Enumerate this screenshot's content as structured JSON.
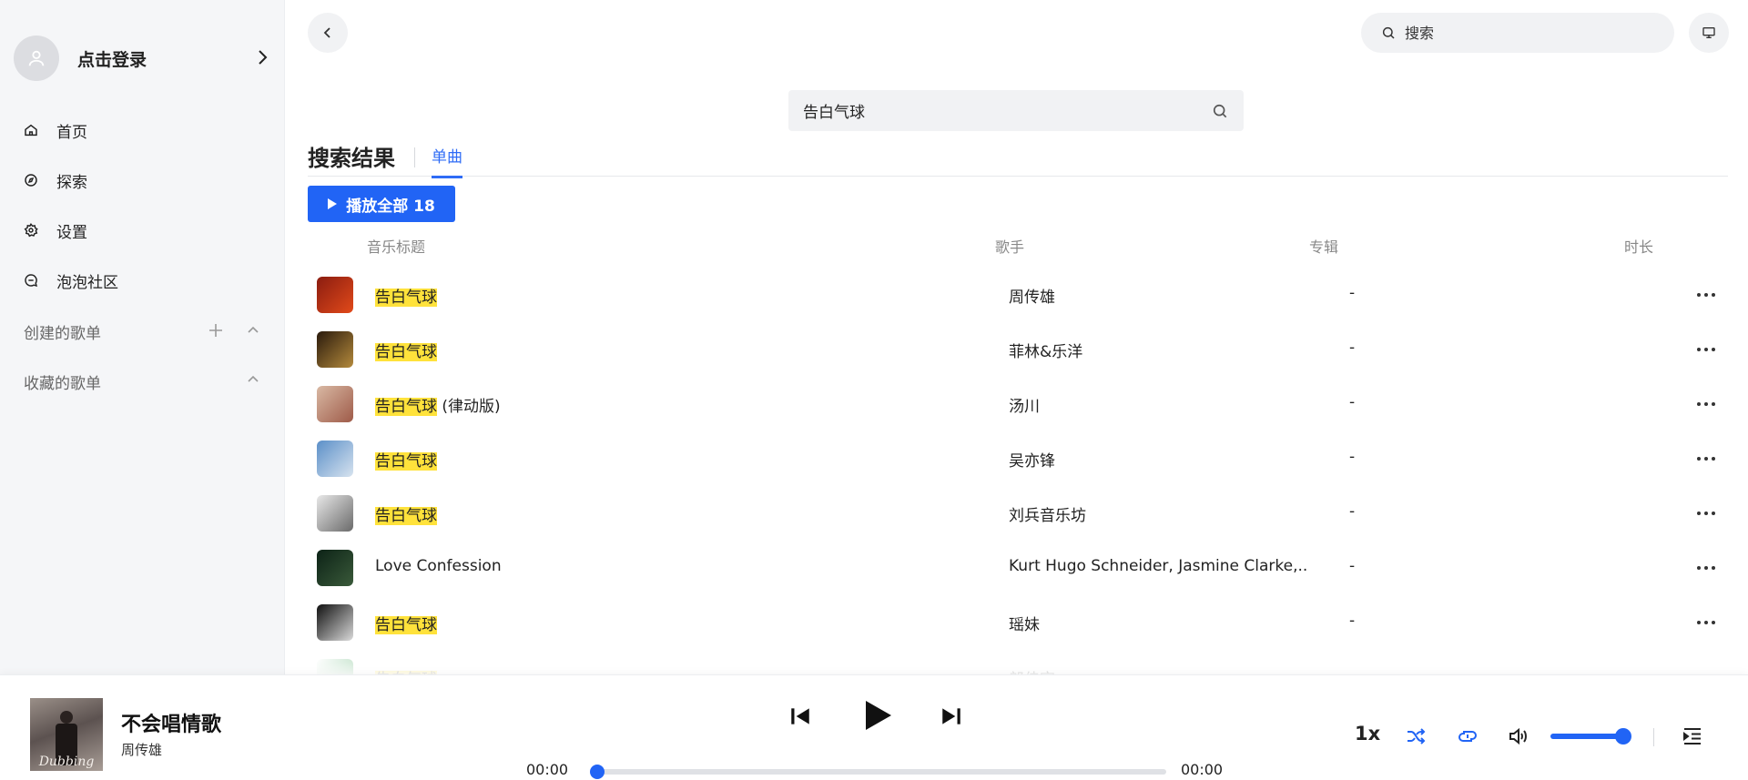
{
  "sidebar": {
    "login_label": "点击登录",
    "nav": [
      {
        "label": "首页",
        "icon": "home-icon"
      },
      {
        "label": "探索",
        "icon": "compass-icon"
      },
      {
        "label": "设置",
        "icon": "gear-icon"
      },
      {
        "label": "泡泡社区",
        "icon": "chat-bubble-icon"
      }
    ],
    "created_playlists": "创建的歌单",
    "collected_playlists": "收藏的歌单"
  },
  "header": {
    "search_placeholder": "搜索"
  },
  "search": {
    "query": "告白气球",
    "results_title": "搜索结果",
    "tab": "单曲",
    "play_all": "播放全部 18"
  },
  "columns": {
    "title": "音乐标题",
    "artist": "歌手",
    "album": "专辑",
    "duration": "时长"
  },
  "songs": [
    {
      "title": "告白气球",
      "suffix": "",
      "artist": "周传雄",
      "duration": "-",
      "cover_colors": [
        "#8a1c10",
        "#e24a1a"
      ]
    },
    {
      "title": "告白气球",
      "suffix": "",
      "artist": "菲林&乐洋",
      "duration": "-",
      "cover_colors": [
        "#2a1a0c",
        "#b48a3c"
      ]
    },
    {
      "title": "告白气球",
      "suffix": " (律动版)",
      "artist": "汤川",
      "duration": "-",
      "cover_colors": [
        "#d9b9a4",
        "#9e5a48"
      ]
    },
    {
      "title": "告白气球",
      "suffix": "",
      "artist": "吴亦锋",
      "duration": "-",
      "cover_colors": [
        "#5b8fc8",
        "#d7e3ef"
      ]
    },
    {
      "title": "告白气球",
      "suffix": "",
      "artist": "刘兵音乐坊",
      "duration": "-",
      "cover_colors": [
        "#e8e8e8",
        "#6a6a6a"
      ]
    },
    {
      "title": "",
      "suffix": "Love Confession",
      "artist": "Kurt Hugo Schneider, Jasmine Clarke,...",
      "duration": "-",
      "cover_colors": [
        "#0c2216",
        "#3a5a3a"
      ]
    },
    {
      "title": "告白气球",
      "suffix": "",
      "artist": "瑶妹",
      "duration": "-",
      "cover_colors": [
        "#101010",
        "#d9d9d9"
      ]
    },
    {
      "title": "告白气球",
      "suffix": "",
      "artist": "郎佳宏",
      "duration": "-",
      "cover_colors": [
        "#ffffff",
        "#2e9a4a"
      ]
    }
  ],
  "player": {
    "title": "不会唱情歌",
    "artist": "周传雄",
    "cover_text": "Dubbing",
    "current_time": "00:00",
    "total_time": "00:00",
    "progress": 0,
    "speed": "1x",
    "volume": 0.9,
    "accent": "#2164f5"
  }
}
